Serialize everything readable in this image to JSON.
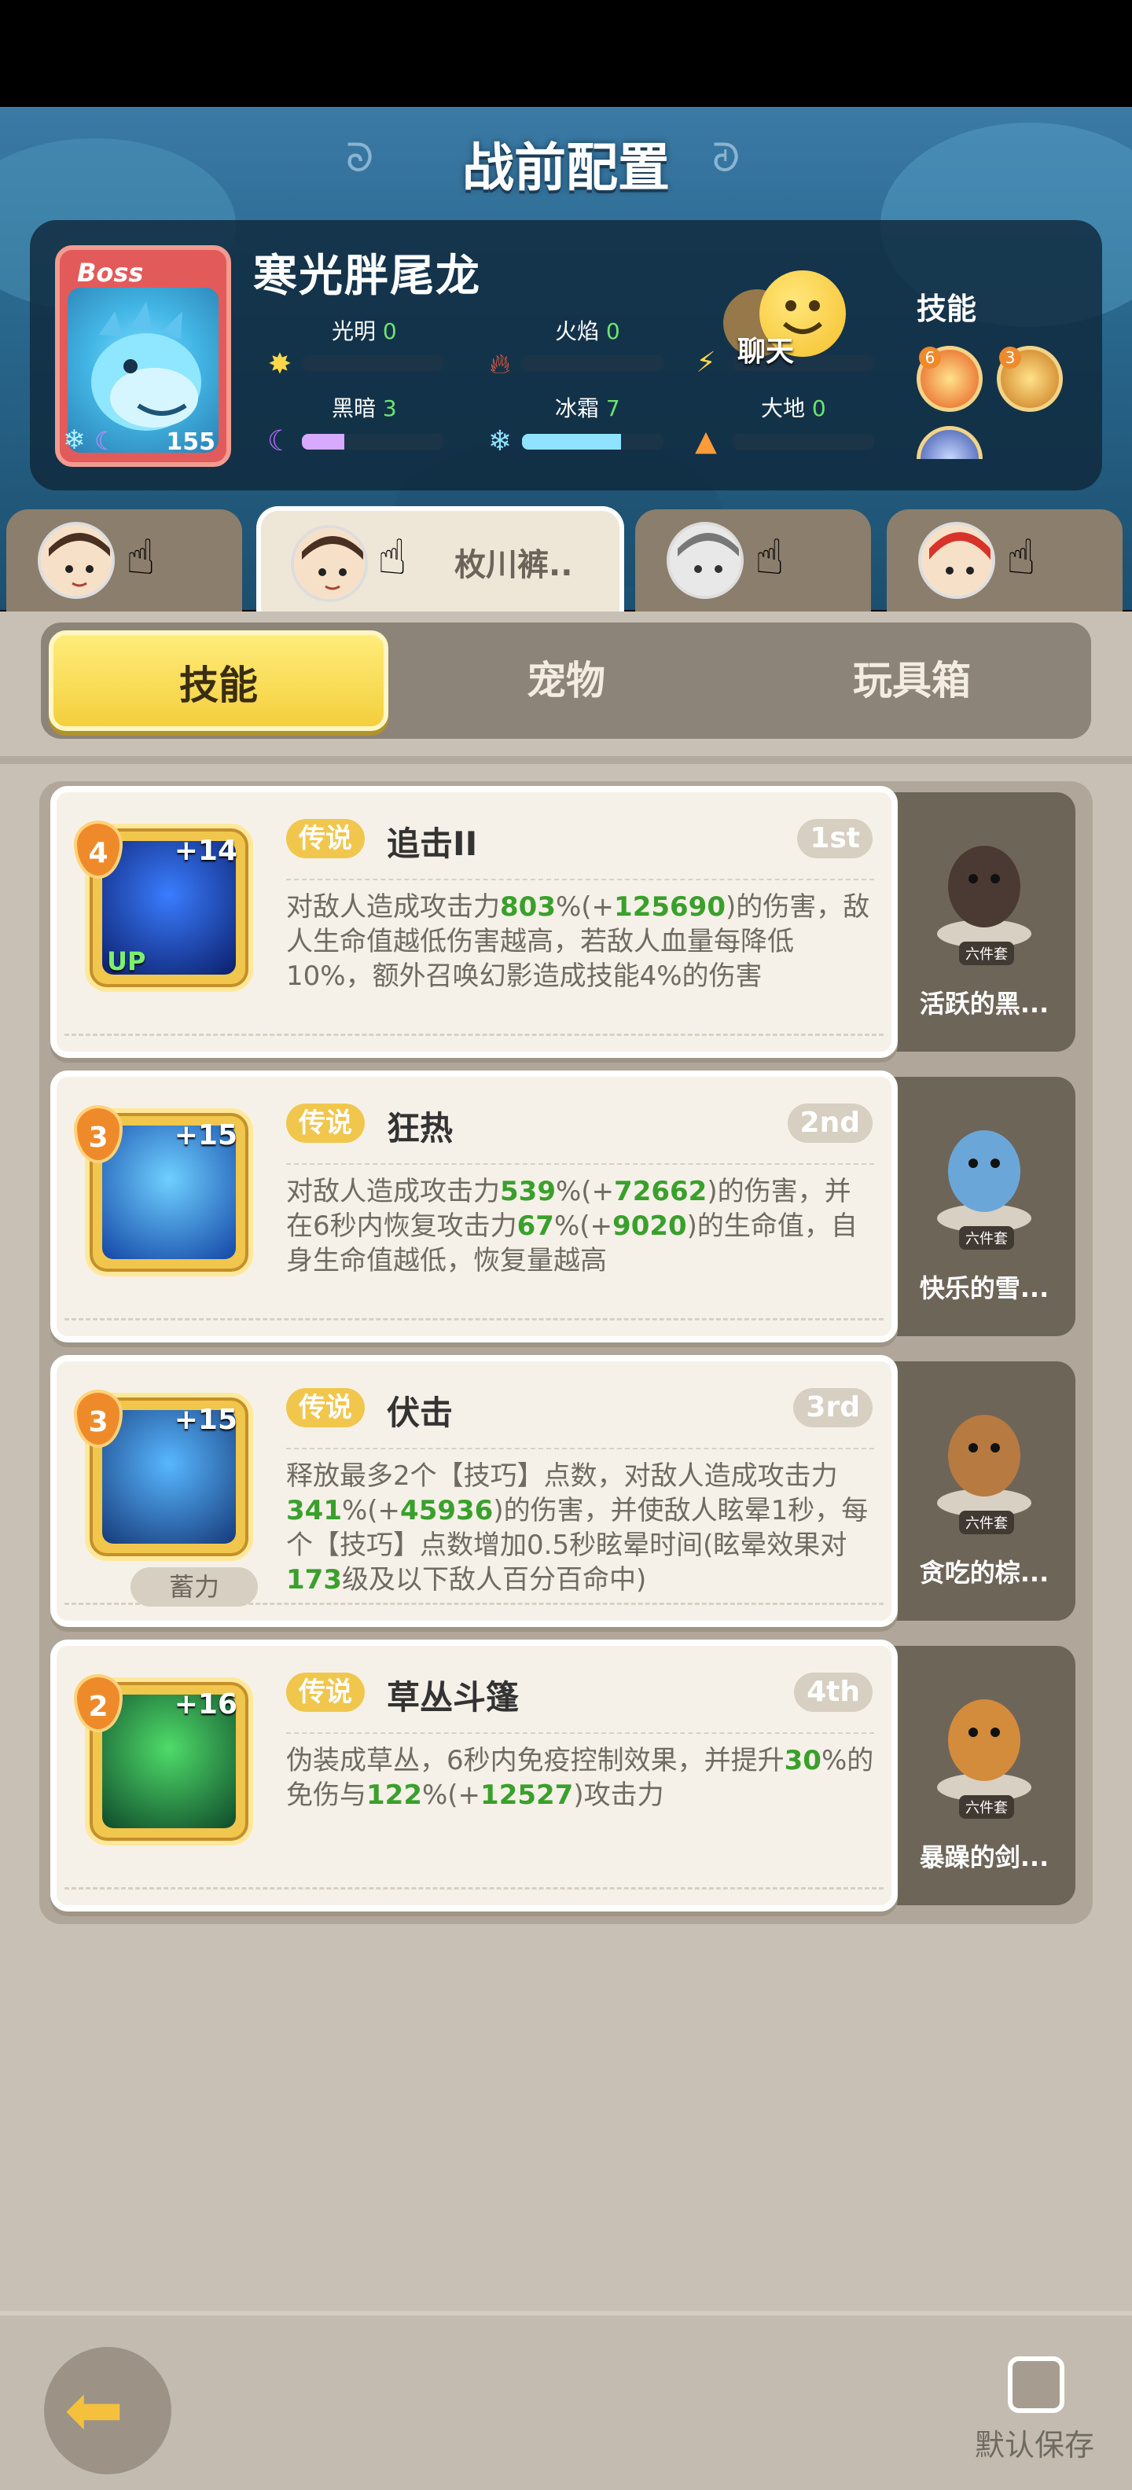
{
  "page_title": "战前配置",
  "boss": {
    "tag": "Boss",
    "level": "155",
    "name": "寒光胖尾龙",
    "stats": [
      {
        "label": "光明",
        "value": "0",
        "fill": 0
      },
      {
        "label": "火焰",
        "value": "0",
        "fill": 0
      },
      {
        "label": "黑暗",
        "value": "3",
        "fill": 0.3
      },
      {
        "label": "冰霜",
        "value": "7",
        "fill": 0.7
      },
      {
        "label": "大地",
        "value": "0",
        "fill": 0
      }
    ],
    "skills_label": "技能",
    "skill_badges": [
      "6",
      "3"
    ]
  },
  "chat": {
    "label": "聊天"
  },
  "team_tabs": [
    {
      "name": "",
      "active": false
    },
    {
      "name": "枚川裤..",
      "active": true
    },
    {
      "name": "",
      "active": false
    },
    {
      "name": "",
      "active": false
    }
  ],
  "sub_tabs": [
    "技能",
    "宠物",
    "玩具箱"
  ],
  "skills": [
    {
      "level": "4",
      "plus": "+14",
      "up": "UP",
      "rarity": "传说",
      "name": "追击II",
      "rank": "1st",
      "desc_parts": [
        "对敌人造成攻击力",
        "803",
        "%(+",
        "125690",
        ")的伤害，敌人生命值越低伤害越高，若敌人血量每降低10%，额外召唤幻影造成技能4%的伤害"
      ],
      "pet_name": "活跃的黑...",
      "pet_tag": "六件套"
    },
    {
      "level": "3",
      "plus": "+15",
      "rarity": "传说",
      "name": "狂热",
      "rank": "2nd",
      "desc_parts": [
        "对敌人造成攻击力",
        "539",
        "%(+",
        "72662",
        ")的伤害，并在6秒内恢复攻击力",
        "67",
        "%(+",
        "9020",
        ")的生命值，自身生命值越低，恢复量越高"
      ],
      "pet_name": "快乐的雪...",
      "pet_tag": "六件套"
    },
    {
      "level": "3",
      "plus": "+15",
      "rarity": "传说",
      "name": "伏击",
      "rank": "3rd",
      "charge": "蓄力",
      "desc_parts": [
        "释放最多2个【技巧】点数，对敌人造成攻击力",
        "341",
        "%(+",
        "45936",
        ")的伤害，并使敌人眩晕1秒，每个【技巧】点数增加0.5秒眩晕时间(眩晕效果对",
        "173",
        "级及以下敌人百分百命中)"
      ],
      "pet_name": "贪吃的棕...",
      "pet_tag": "六件套"
    },
    {
      "level": "2",
      "plus": "+16",
      "rarity": "传说",
      "name": "草丛斗篷",
      "rank": "4th",
      "desc_parts": [
        "伪装成草丛，6秒内免疫控制效果，并提升",
        "30",
        "%的免伤与",
        "122",
        "%(+",
        "12527",
        ")攻击力"
      ],
      "pet_name": "暴躁的剑...",
      "pet_tag": "六件套"
    }
  ],
  "bottom": {
    "save_label": "默认保存",
    "save_checked": false
  },
  "colors": {
    "accent_yellow": "#f4cf3d",
    "green_value": "#3aa02c",
    "card_bg": "#f6f1e8",
    "header_blue": "#2b6a90"
  }
}
